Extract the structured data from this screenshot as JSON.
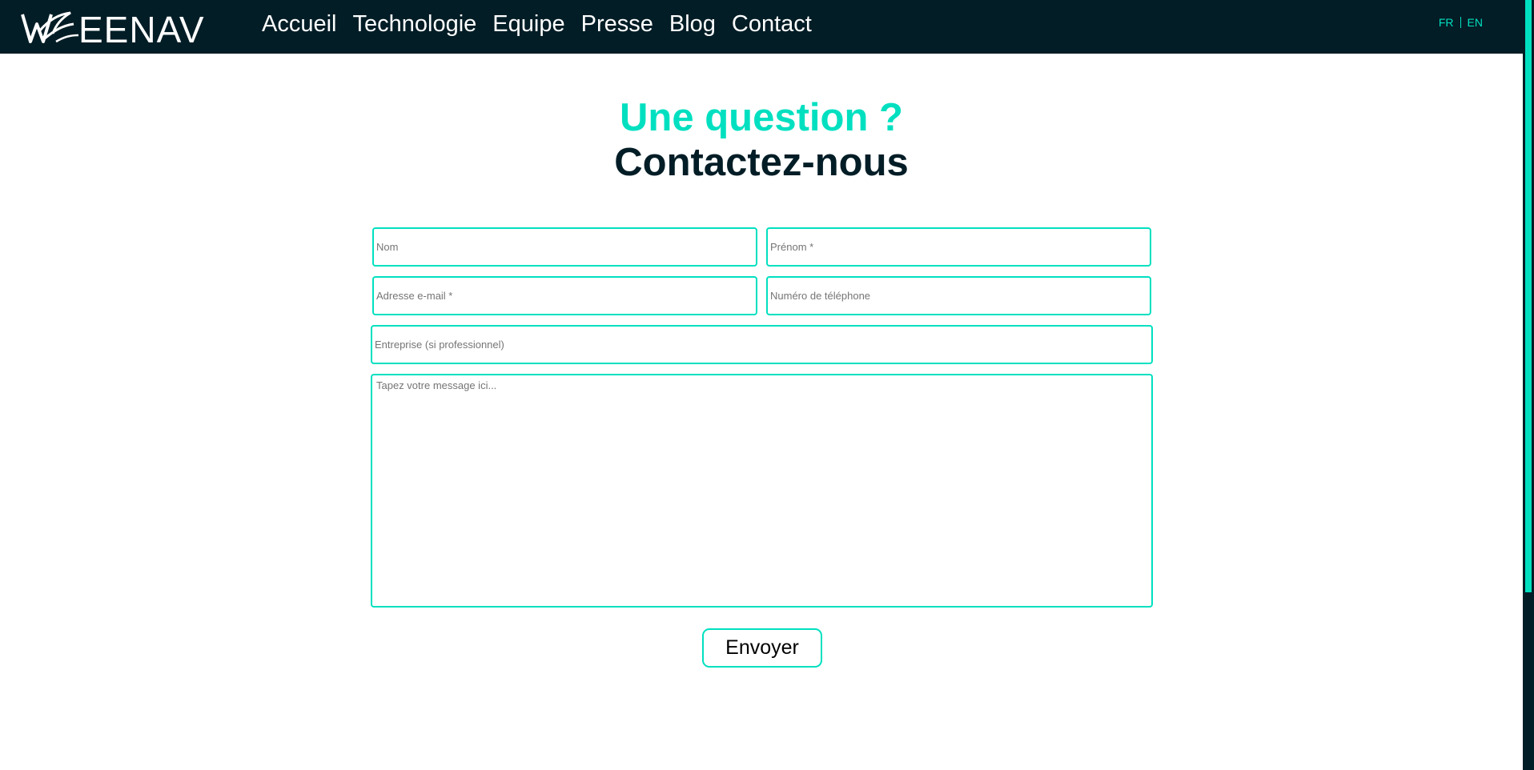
{
  "brand": {
    "logo_text": "WEENAV",
    "nav_bg": "#021d26",
    "accent": "#00e0c0"
  },
  "nav": {
    "items": [
      {
        "label": "Accueil"
      },
      {
        "label": "Technologie"
      },
      {
        "label": "Equipe"
      },
      {
        "label": "Presse"
      },
      {
        "label": "Blog"
      },
      {
        "label": "Contact"
      }
    ]
  },
  "language": {
    "options": [
      "FR",
      "EN"
    ]
  },
  "contact": {
    "heading_accent": "Une question ?",
    "heading_main": "Contactez-nous",
    "form": {
      "last_name_placeholder": "Nom",
      "first_name_placeholder": "Prénom *",
      "email_placeholder": "Adresse e-mail *",
      "phone_placeholder": "Numéro de téléphone",
      "company_placeholder": "Entreprise (si professionnel)",
      "message_placeholder": "Tapez votre message ici...",
      "submit_label": "Envoyer"
    }
  }
}
